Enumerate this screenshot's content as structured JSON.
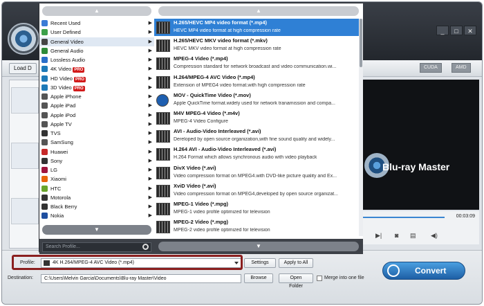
{
  "toolbar": {
    "load_label": "Load D",
    "cuda_label": "CUDA",
    "amd_label": "AMD"
  },
  "window_buttons": [
    "_",
    "□",
    "✕"
  ],
  "preview": {
    "brand": "Blu-ray Master",
    "timecode": "00:03:09"
  },
  "bottom": {
    "profile_label": "Profile:",
    "profile_value": "4K H.264/MPEG-4 AVC Video (*.mp4)",
    "settings_label": "Settings",
    "apply_all_label": "Apply to All",
    "destination_label": "Destination:",
    "destination_value": "C:\\Users\\Melvin Garcia\\Documents\\Blu-ray Master\\Video",
    "browse_label": "Browse",
    "open_folder_label": "Open Folder",
    "merge_label": "Merge into one file",
    "convert_label": "Convert"
  },
  "menu": {
    "scroll_up": "▲",
    "scroll_down": "▼",
    "search_placeholder": "Search Profile...",
    "categories": [
      {
        "label": "Recent Used",
        "color": "#3a7bd5"
      },
      {
        "label": "User Defined",
        "color": "#3ca04a"
      },
      {
        "label": "General Video",
        "color": "#444",
        "selected": true
      },
      {
        "label": "General Audio",
        "color": "#2e8b3a"
      },
      {
        "label": "Lossless Audio",
        "color": "#2a6fc9"
      },
      {
        "label": "4K Video",
        "color": "#1d7ab8",
        "pro": "PRO"
      },
      {
        "label": "HD Video",
        "color": "#1d7ab8",
        "pro": "PRO"
      },
      {
        "label": "3D Video",
        "color": "#1d7ab8",
        "pro": "PRO"
      },
      {
        "label": "Apple iPhone",
        "color": "#555"
      },
      {
        "label": "Apple iPad",
        "color": "#555"
      },
      {
        "label": "Apple iPod",
        "color": "#555"
      },
      {
        "label": "Apple TV",
        "color": "#555"
      },
      {
        "label": "TVS",
        "color": "#333"
      },
      {
        "label": "SamSung",
        "color": "#555"
      },
      {
        "label": "Huawei",
        "color": "#c62828"
      },
      {
        "label": "Sony",
        "color": "#333"
      },
      {
        "label": "LG",
        "color": "#a0143c"
      },
      {
        "label": "Xiaomi",
        "color": "#e8650a"
      },
      {
        "label": "HTC",
        "color": "#6aa52b"
      },
      {
        "label": "Motorola",
        "color": "#333"
      },
      {
        "label": "Black Berry",
        "color": "#333"
      },
      {
        "label": "Nokia",
        "color": "#1f4fa0"
      }
    ],
    "formats": [
      {
        "name": "H.265/HEVC MP4 video format (*.mp4)",
        "desc": "HEVC MP4 video format at high compression rate",
        "selected": true
      },
      {
        "name": "H.265/HEVC MKV video format (*.mkv)",
        "desc": "HEVC MKV video format at high compression rate"
      },
      {
        "name": "MPEG-4 Video (*.mp4)",
        "desc": "Compression standard for network broadcast and video communication.wi..."
      },
      {
        "name": "H.264/MPEG-4 AVC Video (*.mp4)",
        "desc": "Extension of MPEG4 video format.with high compression rate"
      },
      {
        "name": "MOV - QuickTime Video (*.mov)",
        "desc": "Apple QuickTime format.widely used for network tranamission and compa...",
        "quicktime": true
      },
      {
        "name": "M4V MPEG-4 Video (*.m4v)",
        "desc": "MPEG-4 Video Configure"
      },
      {
        "name": "AVI - Audio-Video Interleaved (*.avi)",
        "desc": "Dereloped by open source organization,with fine sound quality and widely..."
      },
      {
        "name": "H.264 AVI - Audio-Video Interleaved (*.avi)",
        "desc": "H.264 Format which allows synchronous audio with video playback"
      },
      {
        "name": "DivX Video (*.avi)",
        "desc": "Video compression format on MPEG4.with DVD-like picture quality and Ex..."
      },
      {
        "name": "XviD Video (*.avi)",
        "desc": "Video compression format on MPEG4,developed by open source organizat..."
      },
      {
        "name": "MPEG-1 Video (*.mpg)",
        "desc": "MPEG-1 video profile optimized for television"
      },
      {
        "name": "MPEG-2 Video (*.mpg)",
        "desc": "MPEG-2 video profile optimized for television"
      }
    ]
  }
}
